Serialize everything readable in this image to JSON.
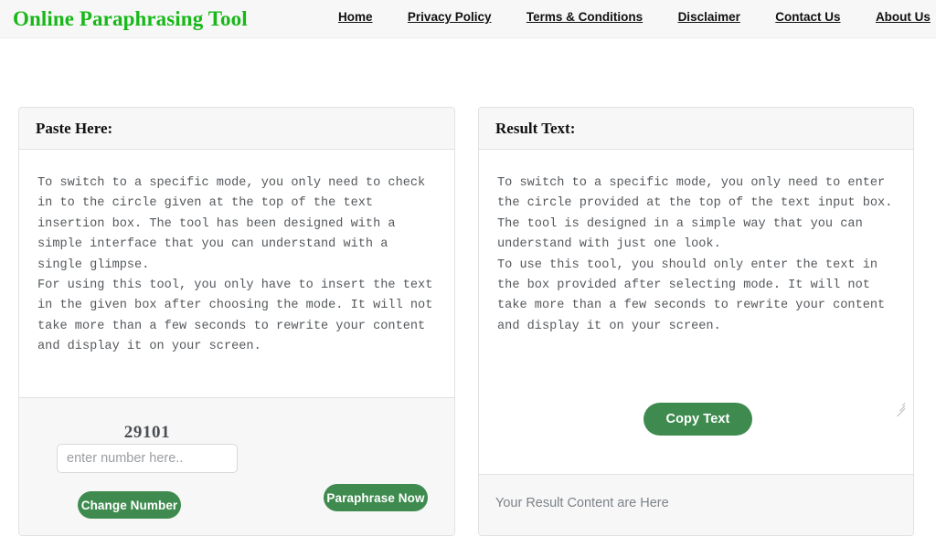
{
  "header": {
    "brand": "Online Paraphrasing Tool",
    "brand_color": "#18b818",
    "nav": [
      {
        "label": "Home"
      },
      {
        "label": "Privacy Policy"
      },
      {
        "label": "Terms & Conditions"
      },
      {
        "label": "Disclaimer"
      },
      {
        "label": "Contact Us"
      },
      {
        "label": "About Us"
      }
    ]
  },
  "accent_color": "#3f8b4f",
  "left_panel": {
    "title": "Paste Here:",
    "textarea_value": "To switch to a specific mode, you only need to check in to the circle given at the top of the text insertion box. The tool has been designed with a simple interface that you can understand with a single glimpse.\nFor using this tool, you only have to insert the text in the given box after choosing the mode. It will not take more than a few seconds to rewrite your content and display it on your screen.",
    "captcha_number": "29101",
    "number_input_value": "",
    "number_input_placeholder": "enter number here..",
    "change_number_label": "Change Number",
    "paraphrase_label": "Paraphrase Now"
  },
  "right_panel": {
    "title": "Result Text:",
    "textarea_value": "To switch to a specific mode, you only need to enter the circle provided at the top of the text input box. The tool is designed in a simple way that you can understand with just one look.\nTo use this tool, you should only enter the text in the box provided after selecting mode. It will not take more than a few seconds to rewrite your content and display it on your screen.",
    "copy_label": "Copy Text",
    "result_placeholder": "Your Result Content are Here"
  }
}
